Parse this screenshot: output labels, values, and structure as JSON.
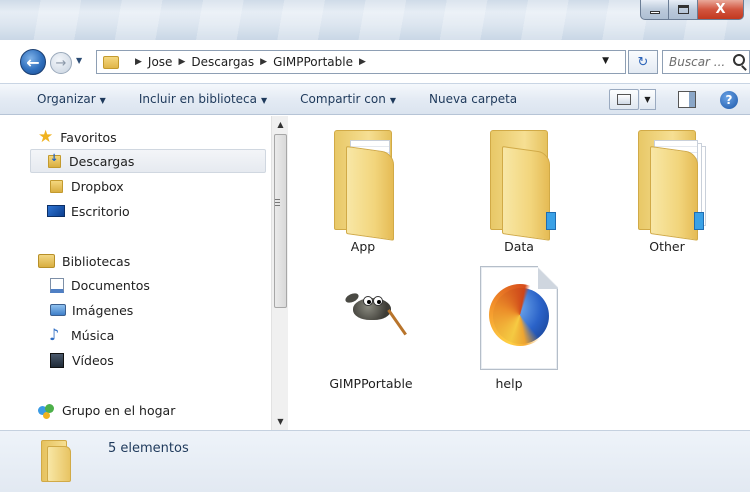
{
  "window": {
    "close_glyph": "X"
  },
  "nav": {
    "breadcrumb": [
      "Jose",
      "Descargas",
      "GIMPPortable"
    ],
    "search_placeholder": "Buscar ..."
  },
  "toolbar": {
    "organize": "Organizar",
    "include_library": "Incluir en biblioteca",
    "share_with": "Compartir con",
    "new_folder": "Nueva carpeta"
  },
  "sidebar": {
    "favorites_label": "Favoritos",
    "favorites": [
      "Descargas",
      "Dropbox",
      "Escritorio"
    ],
    "selected": "Descargas",
    "libraries_label": "Bibliotecas",
    "libraries": [
      "Documentos",
      "Imágenes",
      "Música",
      "Vídeos"
    ],
    "homegroup_label": "Grupo en el hogar"
  },
  "files": [
    {
      "name": "App",
      "icon": "folder-with-documents-icon"
    },
    {
      "name": "Data",
      "icon": "folder-icon"
    },
    {
      "name": "Other",
      "icon": "folder-with-many-documents-icon"
    },
    {
      "name": "GIMPPortable",
      "icon": "gimp-application-icon"
    },
    {
      "name": "help",
      "icon": "firefox-html-document-icon"
    }
  ],
  "status": {
    "item_count": "5 elementos"
  },
  "colors": {
    "accent": "#2f6fbd",
    "toolbar_text": "#1e395b",
    "folder_yellow": "#f2d57c",
    "close_red": "#c2381f"
  }
}
